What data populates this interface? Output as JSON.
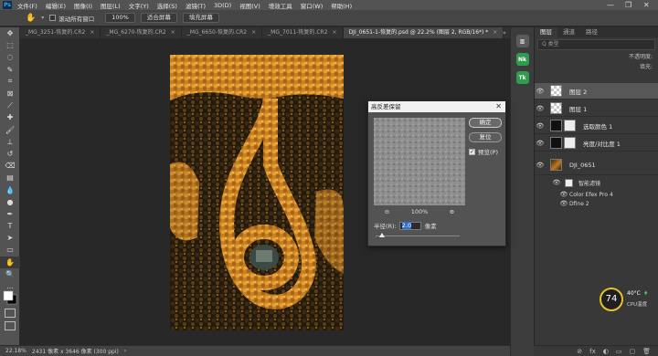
{
  "menubar": {
    "logo": "Ps",
    "items": [
      "文件(F)",
      "编辑(E)",
      "图像(I)",
      "图层(L)",
      "文字(Y)",
      "选择(S)",
      "滤镜(T)",
      "3D(D)",
      "视图(V)",
      "增效工具",
      "窗口(W)",
      "帮助(H)"
    ],
    "controls": [
      "—",
      "❐",
      "✕"
    ]
  },
  "optionsbar": {
    "checkbox_label": "滚动所有窗口",
    "zoom_value": "100%",
    "fit_button": "适合屏幕",
    "fill_button": "填充屏幕"
  },
  "tabs": [
    {
      "label": "_MG_3251-恢复的.CR2",
      "close": "×"
    },
    {
      "label": "_MG_6270-恢复的.CR2",
      "close": "×"
    },
    {
      "label": "_MG_6650-恢复的.CR2",
      "close": "×"
    },
    {
      "label": "_MG_7011-恢复的.CR2",
      "close": "×"
    },
    {
      "label": "DJI_0651-1-恢复的.psd @ 22.2% (图层 2, RGB/16*) *",
      "close": "×"
    }
  ],
  "tabs_more": "»",
  "statusbar": {
    "zoom": "22.18%",
    "info": "2431 像素 x 3646 像素 (300 ppi)",
    "arrow": "›"
  },
  "layers_panel": {
    "tabs": [
      "图层",
      "通道",
      "路径"
    ],
    "filter_label": "Q 类型",
    "opacity_label": "不透明度:",
    "fill_label": "填充:",
    "layers": [
      {
        "name": "图层 2",
        "thumb": "gray",
        "selected": true
      },
      {
        "name": "图层 1",
        "thumb": "gray",
        "selected": false
      },
      {
        "name": "选取颜色 1",
        "thumb": "white",
        "selected": false
      },
      {
        "name": "亮度/对比度 1",
        "thumb": "white",
        "selected": false
      },
      {
        "name": "DJI_0651",
        "thumb": "photo",
        "selected": false
      }
    ],
    "smart_filters_label": "智能滤镜",
    "filters": [
      "Color Efex Pro 4",
      "Dfine 2"
    ],
    "eye": "👁"
  },
  "dialog": {
    "title": "高反差保留",
    "ok": "确定",
    "reset": "复位",
    "preview_check": "✓",
    "preview_label": "预览(P)",
    "zoom_out": "⊖",
    "zoom_level": "100%",
    "zoom_in": "⊕",
    "radius_label": "半径(R):",
    "radius_value": "2.0",
    "unit": "像素",
    "radius_fraction": 0.08,
    "close": "✕"
  },
  "widget": {
    "cpu_percent": "74",
    "cpu_temp": "40°C",
    "cpu_label": "CPU温度",
    "leaf": "♦"
  },
  "bottom_icons": [
    "⊘",
    "fx",
    "◐",
    "▭",
    "▢",
    "🗑"
  ],
  "colors": {
    "accent": "#31a8ff",
    "panel": "#383838",
    "canvas": "#282828",
    "foliage": "#c47a1c"
  }
}
